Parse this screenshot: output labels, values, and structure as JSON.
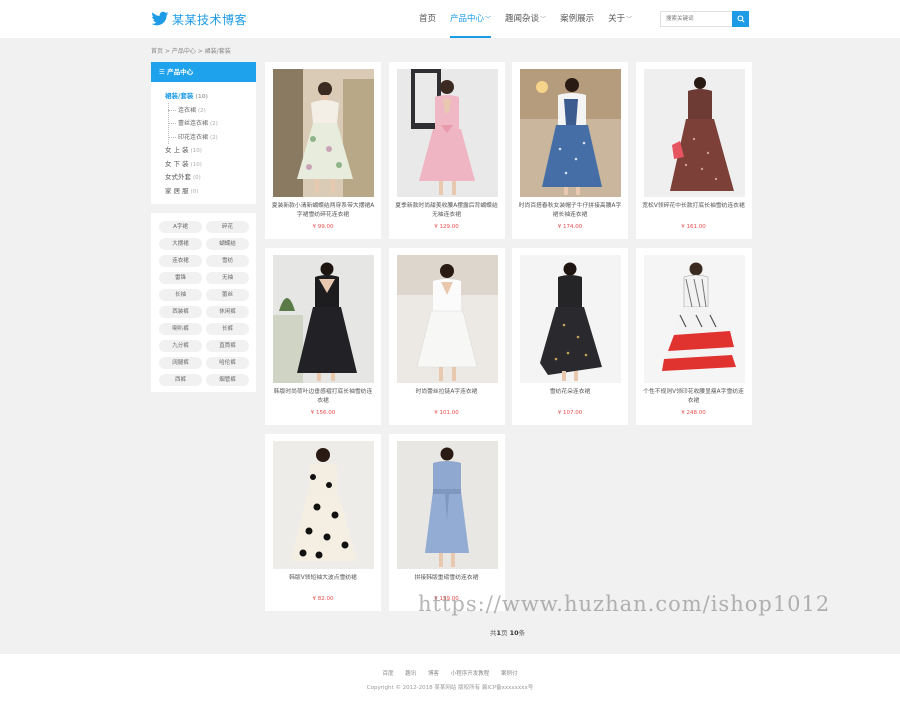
{
  "site": {
    "name": "某某技术博客",
    "accent": "#1e9be6"
  },
  "nav": [
    {
      "label": "首页",
      "active": false,
      "dropdown": false
    },
    {
      "label": "产品中心",
      "active": true,
      "dropdown": true
    },
    {
      "label": "趣闻杂谈",
      "active": false,
      "dropdown": true
    },
    {
      "label": "案例展示",
      "active": false,
      "dropdown": false
    },
    {
      "label": "关于",
      "active": false,
      "dropdown": true
    }
  ],
  "search": {
    "placeholder": "搜索关键词",
    "icon": "search-icon"
  },
  "breadcrumb": "首页 > 产品中心 > 裙装/套装",
  "sidebar": {
    "heading": "产品中心",
    "categories": [
      {
        "label": "裙装/套装",
        "count": "(10)",
        "level": 0,
        "active": true
      },
      {
        "label": "连衣裙",
        "count": "(2)",
        "level": 1,
        "active": false
      },
      {
        "label": "蕾丝连衣裙",
        "count": "(2)",
        "level": 1,
        "active": false
      },
      {
        "label": "印花连衣裙",
        "count": "(2)",
        "level": 1,
        "active": false
      },
      {
        "label": "女 上 装",
        "count": "(10)",
        "level": 0,
        "active": false
      },
      {
        "label": "女 下 装",
        "count": "(10)",
        "level": 0,
        "active": false
      },
      {
        "label": "女式外套",
        "count": "(0)",
        "level": 0,
        "active": false
      },
      {
        "label": "家 居 服",
        "count": "(0)",
        "level": 0,
        "active": false
      }
    ],
    "tags": [
      "A字裙",
      "碎花",
      "大摆裙",
      "蝴蝶结",
      "连衣裙",
      "雪纺",
      "雷锋",
      "无袖",
      "长袖",
      "蕾丝",
      "西装裤",
      "休闲裤",
      "喇叭裤",
      "长裤",
      "九分裤",
      "直筒裤",
      "阔腿裤",
      "哈伦裤",
      "西裤",
      "烟管裤"
    ]
  },
  "products": [
    {
      "title": "夏装新款小清新蝴蝶结两穿系带大摆裙A字裙雪纺碎花连衣裙",
      "price": "¥ 99.00"
    },
    {
      "title": "夏季新款时尚甜美收腰A摆露后背蝴蝶结无袖连衣裙",
      "price": "¥ 129.00"
    },
    {
      "title": "时尚百搭春秋女装帽子牛仔拼接高腰A字裙长袖连衣裙",
      "price": "¥ 174.00"
    },
    {
      "title": "宽松V领碎花中长款打底长袖雪纺连衣裙",
      "price": "¥ 161.00"
    },
    {
      "title": "韩版时尚荷叶边垂感褶打底长袖雪纺连衣裙",
      "price": "¥ 156.00"
    },
    {
      "title": "时尚蕾丝拉链A字连衣裙",
      "price": "¥ 101.00"
    },
    {
      "title": "雪纺花朵连衣裙",
      "price": "¥ 107.00"
    },
    {
      "title": "个性不规则V领印花收腰显瘦A字雪纺连衣裙",
      "price": "¥ 248.00"
    },
    {
      "title": "韩版V领短袖大波点雪纺裙",
      "price": "¥ 82.00"
    },
    {
      "title": "拼接韩版重磅雪纺连衣裙",
      "price": "¥ 159.00"
    }
  ],
  "pagination": {
    "prefix": "共",
    "pages": "1",
    "mid": "页 ",
    "items": "10",
    "suffix": "条"
  },
  "footer": {
    "links": [
      "百度",
      "趣讯",
      "博客",
      "小程序开发教程",
      "案例讨"
    ],
    "copyright": "Copyright © 2012-2018 某某网站 版权所有    冀ICP备xxxxxxxx号"
  },
  "watermark": "https://www.huzhan.com/ishop1012"
}
